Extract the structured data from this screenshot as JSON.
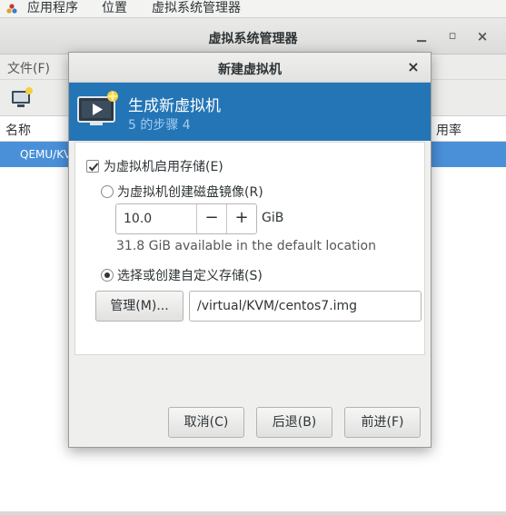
{
  "topbar": {
    "menus": [
      "应用程序",
      "位置",
      "虚拟系统管理器"
    ]
  },
  "main_window": {
    "title": "虚拟系统管理器",
    "menu_file": "文件(F)",
    "columns": [
      "名称",
      "用率"
    ],
    "rows": [
      "QEMU/KVM"
    ]
  },
  "dialog": {
    "title": "新建虚拟机",
    "banner_title": "生成新虚拟机",
    "banner_step": "5 的步骤 4",
    "enable_storage_label": "为虚拟机启用存储(E)",
    "enable_storage_checked": true,
    "create_disk_label": "为虚拟机创建磁盘镜像(R)",
    "create_disk_selected": false,
    "disk_size_value": "10.0",
    "disk_size_unit": "GiB",
    "available_text": "31.8 GiB available in the default location",
    "custom_storage_label": "选择或创建自定义存储(S)",
    "custom_storage_selected": true,
    "manage_button": "管理(M)...",
    "storage_path": "/virtual/KVM/centos7.img",
    "cancel_button": "取消(C)",
    "back_button": "后退(B)",
    "forward_button": "前进(F)"
  },
  "colors": {
    "banner": "#2475b6",
    "selection": "#4a90d9"
  }
}
